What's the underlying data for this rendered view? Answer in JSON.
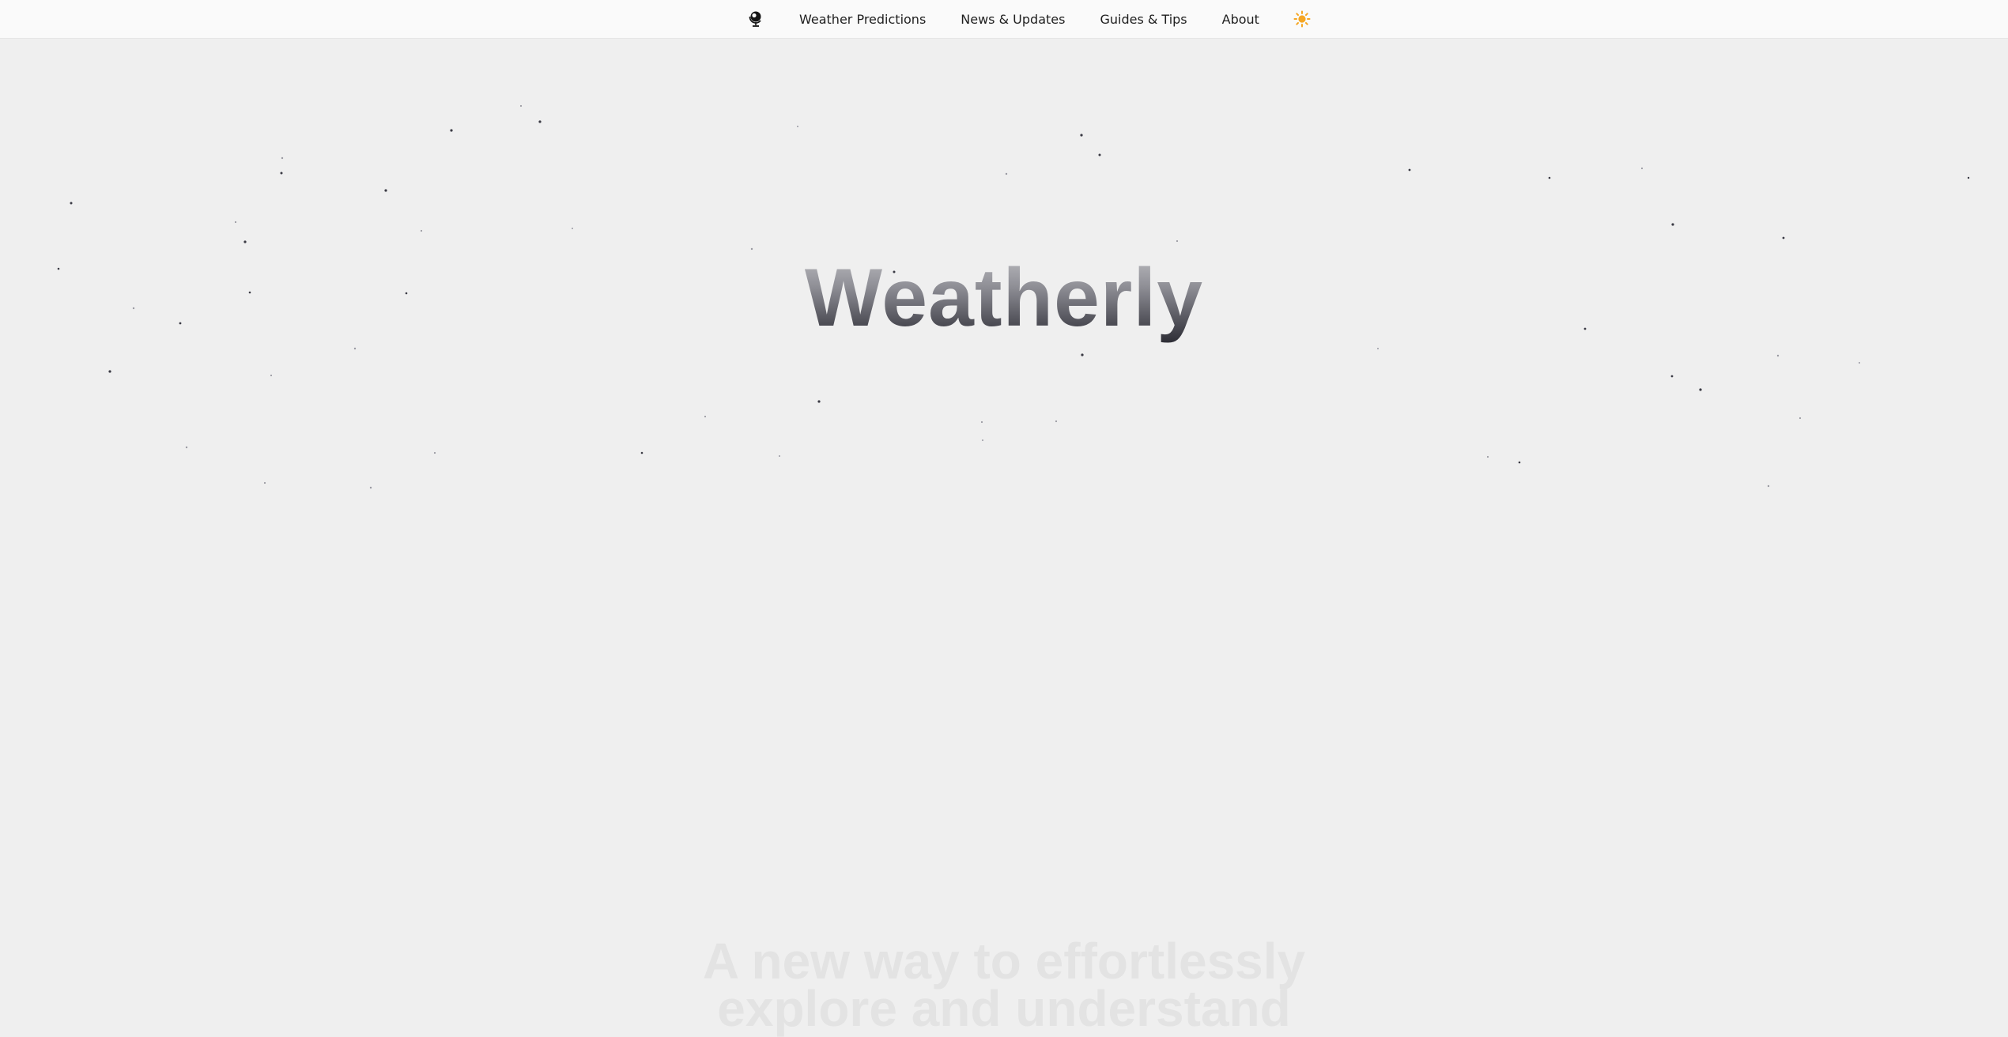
{
  "nav": {
    "logo_icon": "globe-icon",
    "links": [
      {
        "label": "Weather Predictions"
      },
      {
        "label": "News & Updates"
      },
      {
        "label": "Guides & Tips"
      },
      {
        "label": "About"
      }
    ],
    "theme_icon": "sun-icon",
    "theme_icon_color": "#f5a623"
  },
  "hero": {
    "title": "Weatherly",
    "subtitle_line1": "A new way to effortlessly",
    "subtitle_line2": "explore and understand"
  },
  "colors": {
    "background": "#efefef",
    "navbar": "#fafafa",
    "text": "#1f1f1f"
  }
}
